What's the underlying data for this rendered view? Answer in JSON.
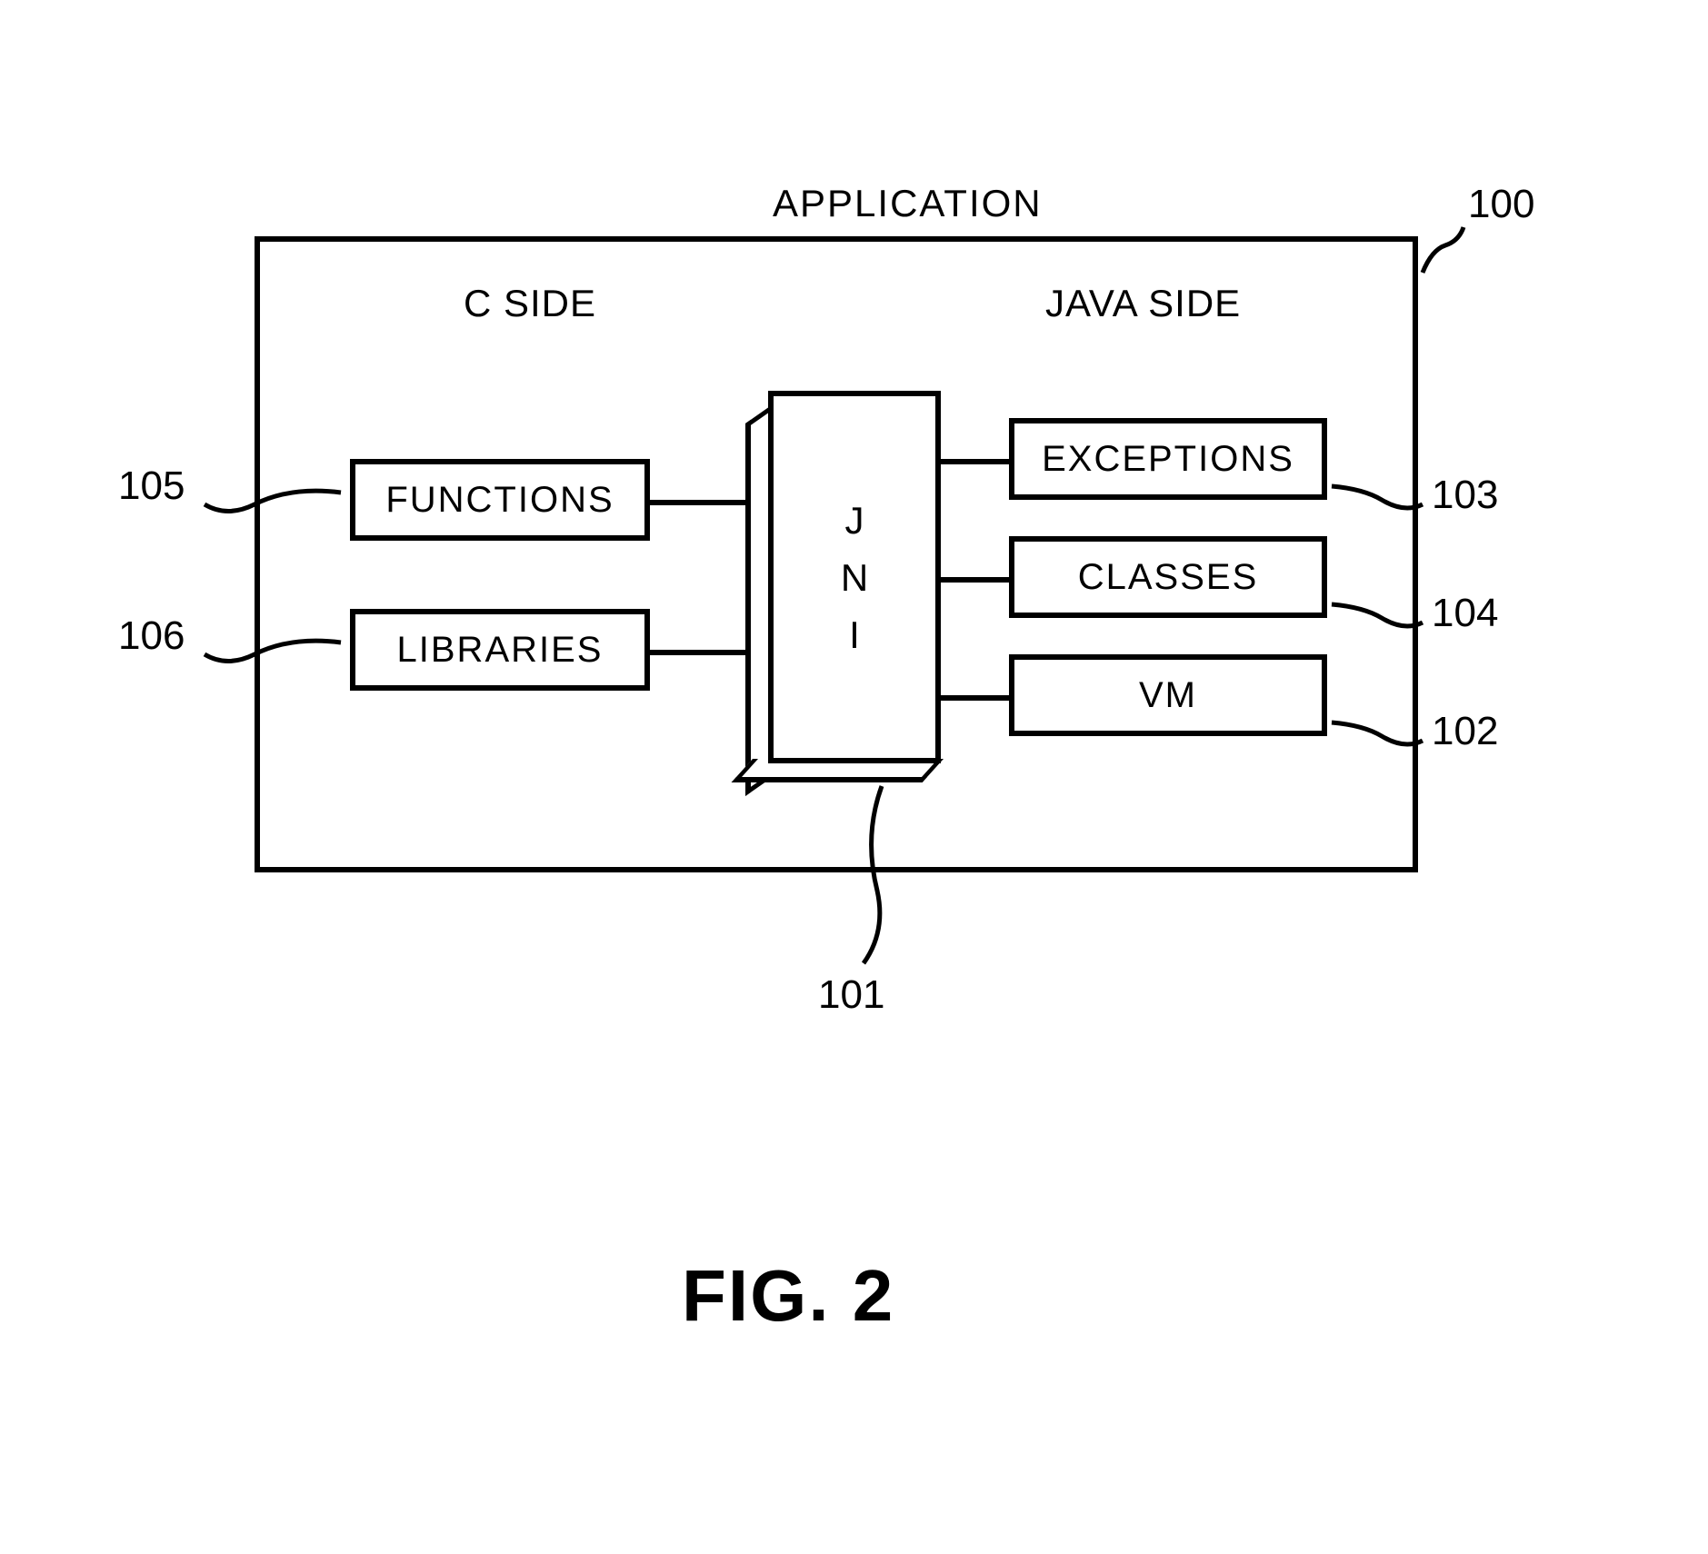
{
  "title": "APPLICATION",
  "c_side_label": "C SIDE",
  "java_side_label": "JAVA SIDE",
  "blocks": {
    "functions": "FUNCTIONS",
    "libraries": "LIBRARIES",
    "jni_j": "J",
    "jni_n": "N",
    "jni_i": "I",
    "exceptions": "EXCEPTIONS",
    "classes": "CLASSES",
    "vm": "VM"
  },
  "refs": {
    "r100": "100",
    "r101": "101",
    "r102": "102",
    "r103": "103",
    "r104": "104",
    "r105": "105",
    "r106": "106"
  },
  "figure": "FIG. 2"
}
